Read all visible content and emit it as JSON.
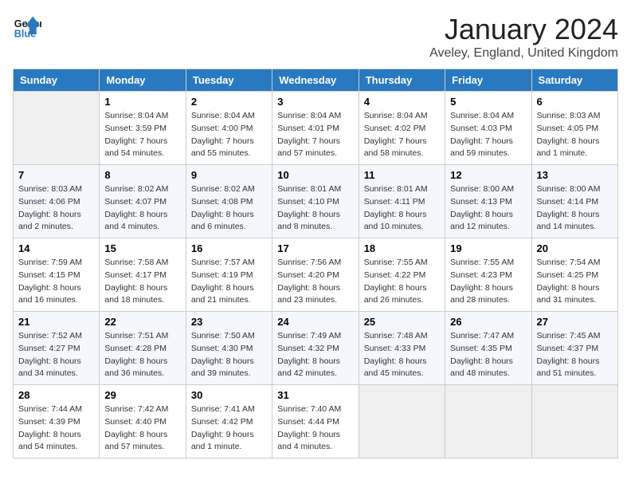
{
  "header": {
    "logo_line1": "General",
    "logo_line2": "Blue",
    "title": "January 2024",
    "subtitle": "Aveley, England, United Kingdom"
  },
  "days_of_week": [
    "Sunday",
    "Monday",
    "Tuesday",
    "Wednesday",
    "Thursday",
    "Friday",
    "Saturday"
  ],
  "weeks": [
    [
      {
        "day": "",
        "info": ""
      },
      {
        "day": "1",
        "info": "Sunrise: 8:04 AM\nSunset: 3:59 PM\nDaylight: 7 hours\nand 54 minutes."
      },
      {
        "day": "2",
        "info": "Sunrise: 8:04 AM\nSunset: 4:00 PM\nDaylight: 7 hours\nand 55 minutes."
      },
      {
        "day": "3",
        "info": "Sunrise: 8:04 AM\nSunset: 4:01 PM\nDaylight: 7 hours\nand 57 minutes."
      },
      {
        "day": "4",
        "info": "Sunrise: 8:04 AM\nSunset: 4:02 PM\nDaylight: 7 hours\nand 58 minutes."
      },
      {
        "day": "5",
        "info": "Sunrise: 8:04 AM\nSunset: 4:03 PM\nDaylight: 7 hours\nand 59 minutes."
      },
      {
        "day": "6",
        "info": "Sunrise: 8:03 AM\nSunset: 4:05 PM\nDaylight: 8 hours\nand 1 minute."
      }
    ],
    [
      {
        "day": "7",
        "info": "Sunrise: 8:03 AM\nSunset: 4:06 PM\nDaylight: 8 hours\nand 2 minutes."
      },
      {
        "day": "8",
        "info": "Sunrise: 8:02 AM\nSunset: 4:07 PM\nDaylight: 8 hours\nand 4 minutes."
      },
      {
        "day": "9",
        "info": "Sunrise: 8:02 AM\nSunset: 4:08 PM\nDaylight: 8 hours\nand 6 minutes."
      },
      {
        "day": "10",
        "info": "Sunrise: 8:01 AM\nSunset: 4:10 PM\nDaylight: 8 hours\nand 8 minutes."
      },
      {
        "day": "11",
        "info": "Sunrise: 8:01 AM\nSunset: 4:11 PM\nDaylight: 8 hours\nand 10 minutes."
      },
      {
        "day": "12",
        "info": "Sunrise: 8:00 AM\nSunset: 4:13 PM\nDaylight: 8 hours\nand 12 minutes."
      },
      {
        "day": "13",
        "info": "Sunrise: 8:00 AM\nSunset: 4:14 PM\nDaylight: 8 hours\nand 14 minutes."
      }
    ],
    [
      {
        "day": "14",
        "info": "Sunrise: 7:59 AM\nSunset: 4:15 PM\nDaylight: 8 hours\nand 16 minutes."
      },
      {
        "day": "15",
        "info": "Sunrise: 7:58 AM\nSunset: 4:17 PM\nDaylight: 8 hours\nand 18 minutes."
      },
      {
        "day": "16",
        "info": "Sunrise: 7:57 AM\nSunset: 4:19 PM\nDaylight: 8 hours\nand 21 minutes."
      },
      {
        "day": "17",
        "info": "Sunrise: 7:56 AM\nSunset: 4:20 PM\nDaylight: 8 hours\nand 23 minutes."
      },
      {
        "day": "18",
        "info": "Sunrise: 7:55 AM\nSunset: 4:22 PM\nDaylight: 8 hours\nand 26 minutes."
      },
      {
        "day": "19",
        "info": "Sunrise: 7:55 AM\nSunset: 4:23 PM\nDaylight: 8 hours\nand 28 minutes."
      },
      {
        "day": "20",
        "info": "Sunrise: 7:54 AM\nSunset: 4:25 PM\nDaylight: 8 hours\nand 31 minutes."
      }
    ],
    [
      {
        "day": "21",
        "info": "Sunrise: 7:52 AM\nSunset: 4:27 PM\nDaylight: 8 hours\nand 34 minutes."
      },
      {
        "day": "22",
        "info": "Sunrise: 7:51 AM\nSunset: 4:28 PM\nDaylight: 8 hours\nand 36 minutes."
      },
      {
        "day": "23",
        "info": "Sunrise: 7:50 AM\nSunset: 4:30 PM\nDaylight: 8 hours\nand 39 minutes."
      },
      {
        "day": "24",
        "info": "Sunrise: 7:49 AM\nSunset: 4:32 PM\nDaylight: 8 hours\nand 42 minutes."
      },
      {
        "day": "25",
        "info": "Sunrise: 7:48 AM\nSunset: 4:33 PM\nDaylight: 8 hours\nand 45 minutes."
      },
      {
        "day": "26",
        "info": "Sunrise: 7:47 AM\nSunset: 4:35 PM\nDaylight: 8 hours\nand 48 minutes."
      },
      {
        "day": "27",
        "info": "Sunrise: 7:45 AM\nSunset: 4:37 PM\nDaylight: 8 hours\nand 51 minutes."
      }
    ],
    [
      {
        "day": "28",
        "info": "Sunrise: 7:44 AM\nSunset: 4:39 PM\nDaylight: 8 hours\nand 54 minutes."
      },
      {
        "day": "29",
        "info": "Sunrise: 7:42 AM\nSunset: 4:40 PM\nDaylight: 8 hours\nand 57 minutes."
      },
      {
        "day": "30",
        "info": "Sunrise: 7:41 AM\nSunset: 4:42 PM\nDaylight: 9 hours\nand 1 minute."
      },
      {
        "day": "31",
        "info": "Sunrise: 7:40 AM\nSunset: 4:44 PM\nDaylight: 9 hours\nand 4 minutes."
      },
      {
        "day": "",
        "info": ""
      },
      {
        "day": "",
        "info": ""
      },
      {
        "day": "",
        "info": ""
      }
    ]
  ]
}
